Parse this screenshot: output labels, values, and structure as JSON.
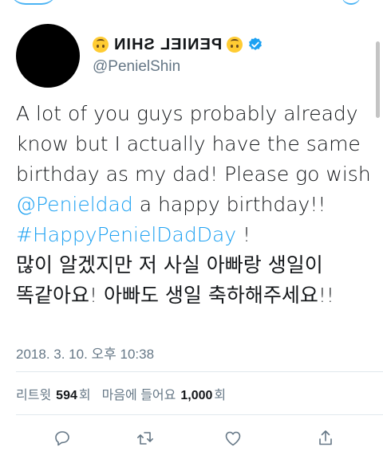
{
  "profile": {
    "display_name": "PENIEL SHIN",
    "handle": "@PenielShin"
  },
  "tweet": {
    "line1": "A lot of you guys probably already",
    "line2": "know but I actually have the same",
    "line3": "birthday as my dad! Please go wish",
    "mention": "@Penieldad",
    "line4_rest": " a happy birthday!!",
    "hashtag": "#HappyPenielDadDay",
    "line5_rest": " !",
    "line6": "많이 알겠지만 저 사실 아빠랑 생일이",
    "line7": "똑같아요! 아빠도 생일 축하해주세요!!"
  },
  "timestamp": "2018. 3. 10. 오후 10:38",
  "stats": {
    "retweet_label": "리트윗",
    "retweet_count": "594",
    "retweet_unit": "회",
    "like_label": "마음에 들어요",
    "like_count": "1,000",
    "like_unit": "회"
  },
  "colors": {
    "link": "#1da1f2",
    "secondary_text": "#657786",
    "verified": "#1da1f2"
  },
  "icons": [
    "reply-icon",
    "retweet-icon",
    "like-icon",
    "share-icon"
  ]
}
